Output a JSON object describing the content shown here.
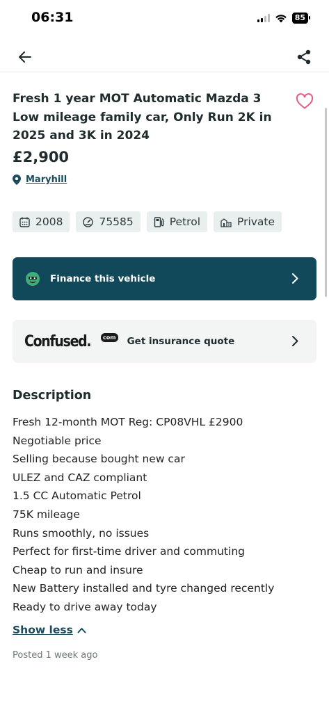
{
  "status_bar": {
    "time": "06:31",
    "battery": "85"
  },
  "listing": {
    "title": "Fresh 1 year MOT Automatic Mazda 3 Low mileage family car, Only Run 2K in 2025 and 3K in 2024",
    "price": "£2,900",
    "location": "Maryhill",
    "specs": [
      {
        "icon": "calendar-icon",
        "label": "2008"
      },
      {
        "icon": "speedometer-icon",
        "label": "75585"
      },
      {
        "icon": "fuel-pump-icon",
        "label": "Petrol"
      },
      {
        "icon": "seller-icon",
        "label": "Private"
      }
    ]
  },
  "finance": {
    "label": "Finance this vehicle"
  },
  "insurance": {
    "logo_word": "Confused.",
    "logo_suffix": "com",
    "label": "Get insurance quote"
  },
  "description": {
    "heading": "Description",
    "lines": [
      "Fresh 12-month MOT Reg: CP08VHL £2900",
      "Negotiable price",
      "Selling because bought new car",
      "ULEZ and CAZ compliant",
      "1.5 CC Automatic Petrol",
      "75K mileage",
      "Runs smoothly, no issues",
      "Perfect for first-time driver and commuting",
      "Cheap to run and insure",
      "New Battery installed and tyre changed recently",
      "Ready to drive away today"
    ],
    "toggle_label": "Show less"
  },
  "posted": "Posted 1 week ago",
  "colors": {
    "brand_teal": "#11485a",
    "link": "#1b4a5a",
    "heart": "#e85a86",
    "chip_bg": "#e9eeee"
  }
}
